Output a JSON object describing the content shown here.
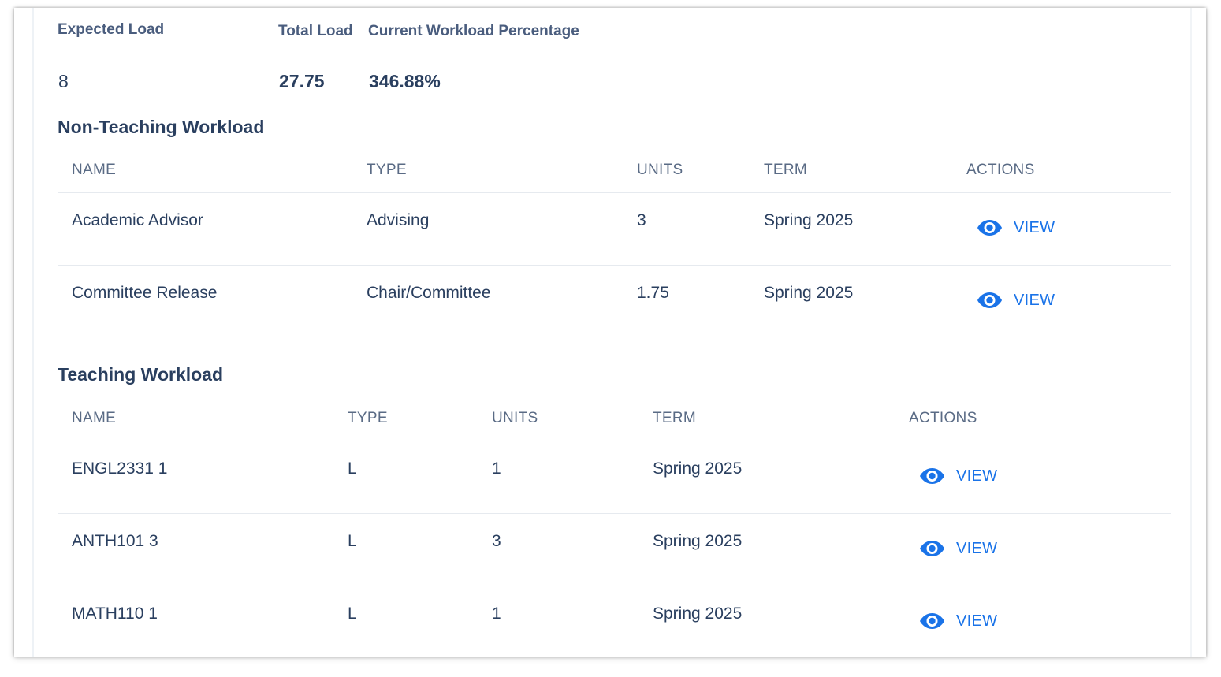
{
  "summary": {
    "expected_load_label": "Expected Load",
    "expected_load_value": "8",
    "total_load_label": "Total Load",
    "total_load_value": "27.75",
    "workload_pct_label": "Current Workload Percentage",
    "workload_pct_value": "346.88%"
  },
  "non_teaching": {
    "title": "Non-Teaching Workload",
    "headers": {
      "name": "NAME",
      "type": "TYPE",
      "units": "UNITS",
      "term": "TERM",
      "actions": "ACTIONS"
    },
    "rows": [
      {
        "name": "Academic Advisor",
        "type": "Advising",
        "units": "3",
        "term": "Spring 2025",
        "action_label": "VIEW",
        "action_icon": "eye-icon"
      },
      {
        "name": "Committee Release",
        "type": "Chair/Committee",
        "units": "1.75",
        "term": "Spring 2025",
        "action_label": "VIEW",
        "action_icon": "eye-icon"
      }
    ]
  },
  "teaching": {
    "title": "Teaching Workload",
    "headers": {
      "name": "NAME",
      "type": "TYPE",
      "units": "UNITS",
      "term": "TERM",
      "actions": "ACTIONS"
    },
    "rows": [
      {
        "name": "ENGL2331 1",
        "type": "L",
        "units": "1",
        "term": "Spring 2025",
        "action_label": "VIEW",
        "action_icon": "eye-icon"
      },
      {
        "name": "ANTH101 3",
        "type": "L",
        "units": "3",
        "term": "Spring 2025",
        "action_label": "VIEW",
        "action_icon": "eye-icon"
      },
      {
        "name": "MATH110 1",
        "type": "L",
        "units": "1",
        "term": "Spring 2025",
        "action_label": "VIEW",
        "action_icon": "eye-icon"
      }
    ]
  },
  "colors": {
    "accent": "#1a73e8",
    "heading": "#2a3f5f",
    "muted": "#5a6b85",
    "divider": "#e6eaef"
  }
}
